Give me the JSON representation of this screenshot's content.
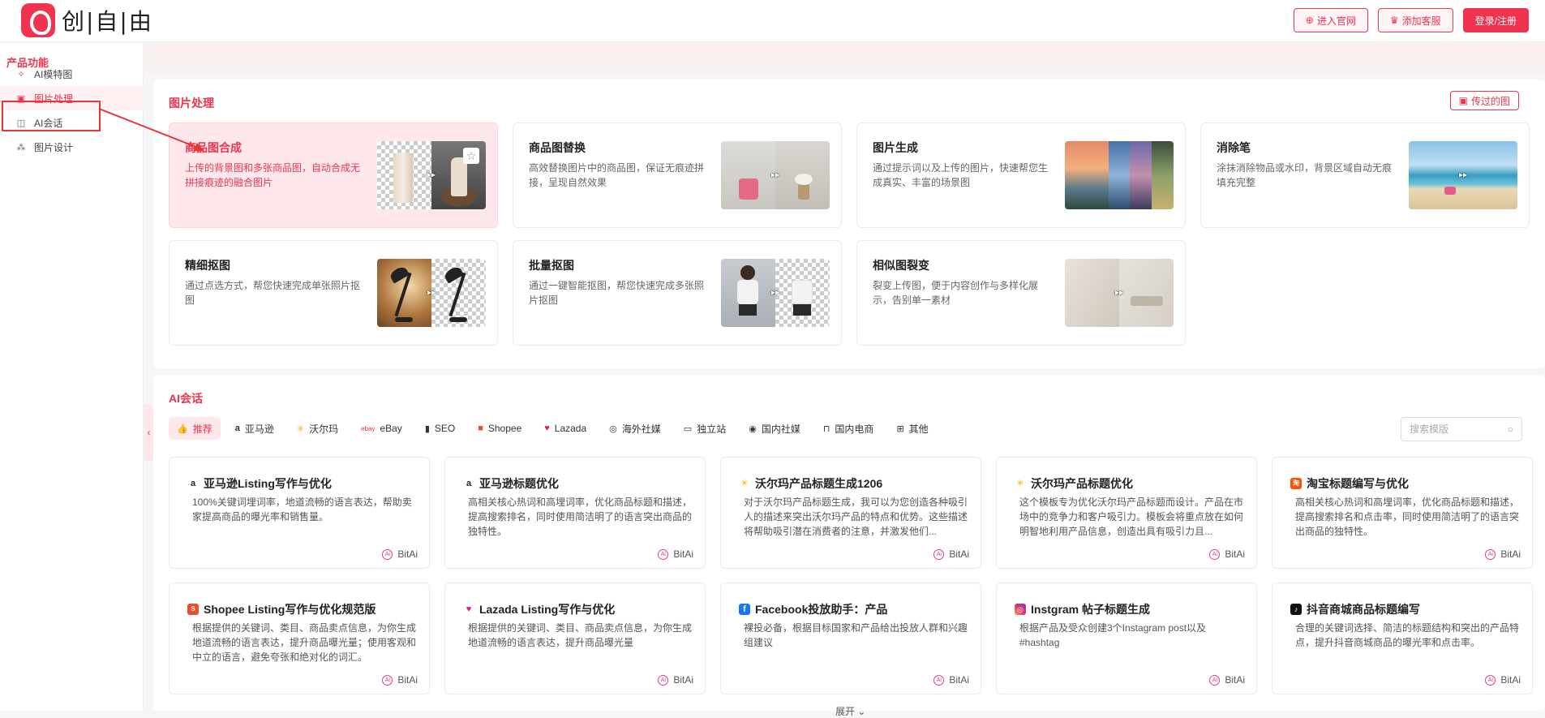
{
  "header": {
    "logo_text": "创|自|由",
    "buttons": [
      {
        "label": "进入官网",
        "icon": "globe-icon"
      },
      {
        "label": "添加客服",
        "icon": "gift-icon"
      },
      {
        "label": "登录/注册"
      }
    ]
  },
  "sidebar": {
    "title": "产品功能",
    "items": [
      {
        "label": "AI模特图",
        "icon": "sparkle-icon"
      },
      {
        "label": "图片处理",
        "icon": "image-icon"
      },
      {
        "label": "AI会话",
        "icon": "chat-icon"
      },
      {
        "label": "图片设计",
        "icon": "design-icon"
      }
    ]
  },
  "image_section": {
    "title": "图片处理",
    "history_button": "传过的图",
    "cards": [
      {
        "title": "商品图合成",
        "desc": "上传的背景图和多张商品图，自动合成无拼接痕迹的融合图片"
      },
      {
        "title": "商品图替换",
        "desc": "高效替换图片中的商品图，保证无痕迹拼接，呈现自然效果"
      },
      {
        "title": "图片生成",
        "desc": "通过提示词以及上传的图片，快速帮您生成真实、丰富的场景图"
      },
      {
        "title": "消除笔",
        "desc": "涂抹消除物品或水印，背景区域自动无痕填充完整"
      },
      {
        "title": "精细抠图",
        "desc": "通过点选方式，帮您快速完成单张照片抠图"
      },
      {
        "title": "批量抠图",
        "desc": "通过一键智能抠图，帮您快速完成多张照片抠图"
      },
      {
        "title": "相似图裂变",
        "desc": "裂变上传图，便于内容创作与多样化展示，告别单一素材"
      }
    ]
  },
  "chat_section": {
    "title": "AI会话",
    "tabs": [
      {
        "label": "推荐",
        "icon": "thumbs-up-icon"
      },
      {
        "label": "亚马逊",
        "icon": "amazon-icon"
      },
      {
        "label": "沃尔玛",
        "icon": "walmart-icon"
      },
      {
        "label": "eBay",
        "icon": "ebay-icon"
      },
      {
        "label": "SEO",
        "icon": "bar-chart-icon"
      },
      {
        "label": "Shopee",
        "icon": "shopee-icon"
      },
      {
        "label": "Lazada",
        "icon": "lazada-icon"
      },
      {
        "label": "海外社媒",
        "icon": "globe-chat-icon"
      },
      {
        "label": "独立站",
        "icon": "store-icon"
      },
      {
        "label": "国内社媒",
        "icon": "target-icon"
      },
      {
        "label": "国内电商",
        "icon": "bag-icon"
      },
      {
        "label": "其他",
        "icon": "grid-icon"
      }
    ],
    "search_placeholder": "搜索模版",
    "cards": [
      {
        "title": "亚马逊Listing写作与优化",
        "icon": "amazon-icon",
        "desc": "100%关键词埋词率，地道流畅的语言表达，帮助卖家提高商品的曝光率和销售量。",
        "author": "BitAi"
      },
      {
        "title": "亚马逊标题优化",
        "icon": "amazon-icon",
        "desc": "高相关核心热词和高埋词率，优化商品标题和描述，提高搜索排名，同时使用简洁明了的语言突出商品的独特性。",
        "author": "BitAi"
      },
      {
        "title": "沃尔玛产品标题生成1206",
        "icon": "walmart-icon",
        "desc": "对于沃尔玛产品标题生成，我可以为您创造各种吸引人的描述来突出沃尔玛产品的特点和优势。这些描述将帮助吸引潜在消费者的注意，并激发他们...",
        "author": "BitAi"
      },
      {
        "title": "沃尔玛产品标题优化",
        "icon": "walmart-icon",
        "desc": "这个模板专为优化沃尔玛产品标题而设计。产品在市场中的竞争力和客户吸引力。模板会将重点放在如何明智地利用产品信息，创造出具有吸引力且...",
        "author": "BitAi"
      },
      {
        "title": "淘宝标题编写与优化",
        "icon": "taobao-icon",
        "desc": "高相关核心热词和高埋词率，优化商品标题和描述，提高搜索排名和点击率，同时使用简洁明了的语言突出商品的独特性。",
        "author": "BitAi"
      },
      {
        "title": "Shopee Listing写作与优化规范版",
        "icon": "shopee-icon",
        "desc": "根据提供的关键词、类目、商品卖点信息，为你生成地道流畅的语言表达，提升商品曝光量；使用客观和中立的语言，避免夸张和绝对化的词汇。",
        "author": "BitAi"
      },
      {
        "title": "Lazada Listing写作与优化",
        "icon": "lazada-icon",
        "desc": "根据提供的关键词、类目、商品卖点信息，为你生成地道流畅的语言表达，提升商品曝光量",
        "author": "BitAi"
      },
      {
        "title": "Facebook投放助手：产品",
        "icon": "facebook-icon",
        "desc": "裸投必备，根据目标国家和产品给出投放人群和兴趣组建议",
        "author": "BitAi"
      },
      {
        "title": "Instgram 帖子标题生成",
        "icon": "instagram-icon",
        "desc": "根据产品及受众创建3个Instagram post以及#hashtag",
        "author": "BitAi"
      },
      {
        "title": "抖音商城商品标题编写",
        "icon": "tiktok-icon",
        "desc": "合理的关键词选择、简洁的标题结构和突出的产品特点，提升抖音商城商品的曝光率和点击率。",
        "author": "BitAi"
      }
    ],
    "expand_label": "展开 ⌄"
  },
  "colors": {
    "accent": "#f0334f",
    "annotation": "#e93535"
  }
}
